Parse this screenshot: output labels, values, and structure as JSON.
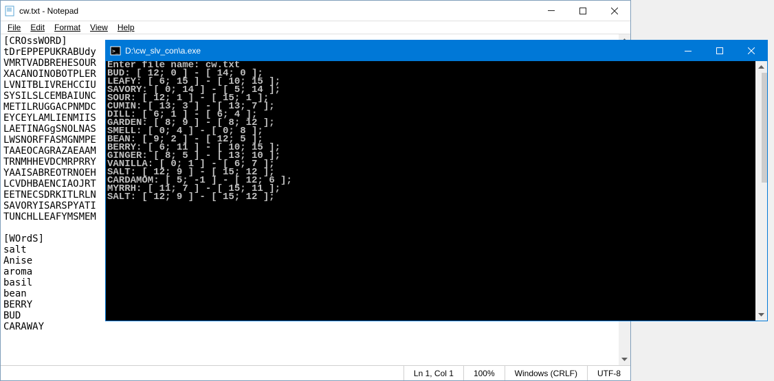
{
  "notepad": {
    "title": "cw.txt - Notepad",
    "menu": {
      "file": "File",
      "edit": "Edit",
      "format": "Format",
      "view": "View",
      "help": "Help"
    },
    "lines": [
      "[CROssWORD]",
      "tDrEPPEPUKRABUdy",
      "VMRTVADBREHESOUR",
      "XACANOINOBOTPLER",
      "LVNITBLIVREHCCIU",
      "SYSILSLCEMBAIUNC",
      "METILRUGGACPNMDC",
      "EYCEYLAMLIENMIIS",
      "LAETINAGgSNOLNAS",
      "LWSNORFFASMGNMPE",
      "TAAEOCAGRAZAEAAM",
      "TRNMHHEVDCMRPRRY",
      "YAAISABREOTRNOEH",
      "LCVDHBAENCIAOJRT",
      "EETNECSDRKITLRLN",
      "SAVORYISARSPYATI",
      "TUNCHLLEAFYMSMEM",
      "",
      "[WOrdS]",
      "salt",
      "Anise",
      "aroma",
      "basil",
      "bean",
      "BERRY",
      "BUD",
      "CARAWAY"
    ],
    "status": {
      "pos": "Ln 1, Col 1",
      "zoom": "100%",
      "crlf": "Windows (CRLF)",
      "encoding": "UTF-8"
    }
  },
  "console": {
    "title": "D:\\cw_slv_con\\a.exe",
    "lines": [
      "Enter file name: cw.txt",
      "BUD: [ 12; 0 ] - [ 14; 0 ];",
      "LEAFY: [ 6; 15 ] - [ 10; 15 ];",
      "SAVORY: [ 0; 14 ] - [ 5; 14 ];",
      "SOUR: [ 12; 1 ] - [ 15; 1 ];",
      "CUMIN: [ 13; 3 ] - [ 13; 7 ];",
      "DILL: [ 6; 1 ] - [ 6; 4 ];",
      "GARDEN: [ 8; 9 ] - [ 8; 12 ];",
      "SMELL: [ 0; 4 ] - [ 0; 8 ];",
      "BEAN: [ 9; 2 ] - [ 12; 5 ];",
      "BERRY: [ 6; 11 ] - [ 10; 15 ];",
      "GINGER: [ 8; 5 ] - [ 13; 10 ];",
      "VANILLA: [ 0; 1 ] - [ 6; 7 ];",
      "SALT: [ 12; 9 ] - [ 15; 12 ];",
      "CARDAMOM: [ 5; -1 ] - [ 12; 6 ];",
      "MYRRH: [ 11; 7 ] - [ 15; 11 ];",
      "SALT: [ 12; 9 ] - [ 15; 12 ];"
    ]
  }
}
